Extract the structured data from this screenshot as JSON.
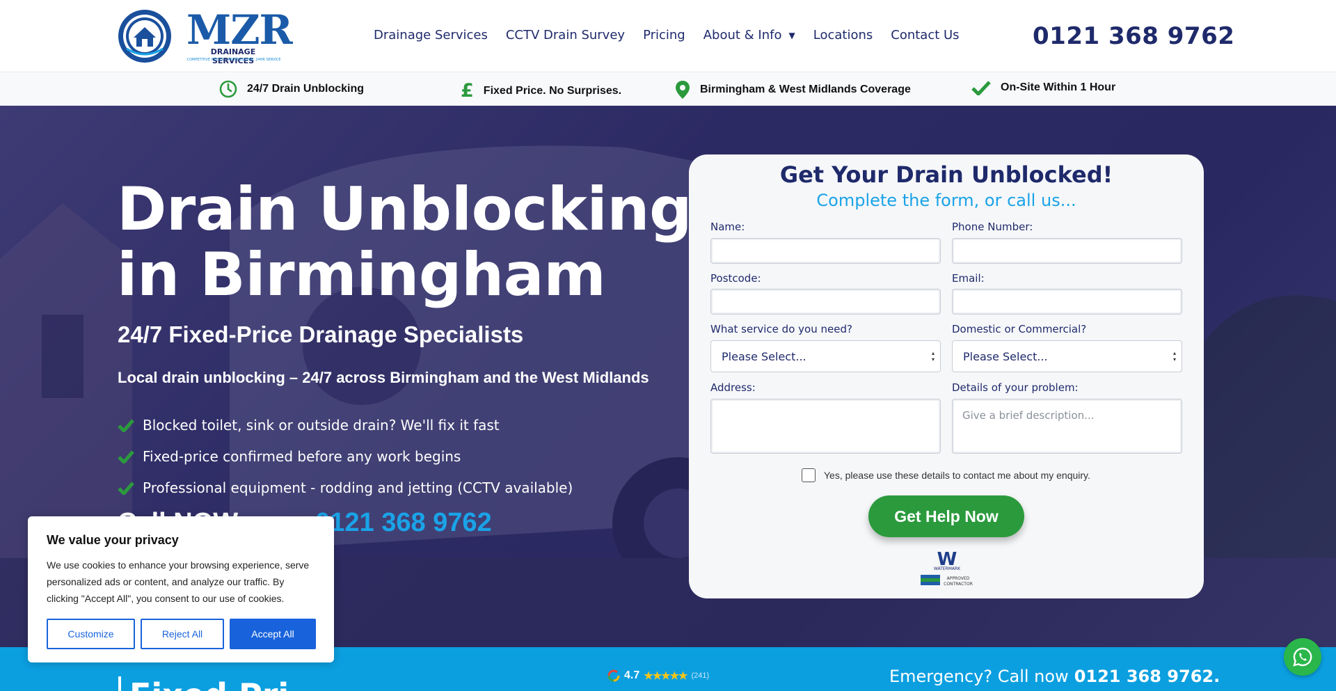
{
  "brand": {
    "name": "MZR",
    "subname": "DRAINAGE SERVICES",
    "tagline": "COMPETITIVE PRICES • PROFESSIONAL 24HR SERVICE",
    "colors": {
      "navy": "#1f2a6b",
      "accent_blue": "#1aa3e8",
      "green": "#2b9a3d",
      "bottom_bar": "#0b9fe0"
    }
  },
  "nav": {
    "items": [
      "Drainage Services",
      "CCTV Drain Survey",
      "Pricing",
      "About & Info",
      "Locations",
      "Contact Us"
    ],
    "dropdown_icon": "caret-down-icon"
  },
  "header_phone": "0121 368 9762",
  "usp": [
    {
      "icon": "clock-icon",
      "text": "24/7 Drain Unblocking"
    },
    {
      "icon": "pound-icon",
      "text": "Fixed Price. No Surprises."
    },
    {
      "icon": "map-pin-icon",
      "text": "Birmingham & West Midlands Coverage"
    },
    {
      "icon": "check-icon",
      "text": "On-Site Within 1 Hour"
    }
  ],
  "hero": {
    "title_line1": "Drain Unblocking",
    "title_line2": "in Birmingham",
    "subtitle": "24/7 Fixed-Price Drainage Specialists",
    "subtitle2": "Local drain unblocking – 24/7 across Birmingham and the West Midlands",
    "checklist": [
      "Blocked toilet, sink or outside drain? We'll fix it fast",
      "Fixed-price confirmed before any work begins",
      "Professional equipment - rodding and jetting (CCTV available)"
    ],
    "call_label": "Call NOW on",
    "call_number": "0121 368 9762"
  },
  "form": {
    "title": "Get Your Drain Unblocked!",
    "subtitle": "Complete the form, or call us...",
    "labels": {
      "name": "Name:",
      "phone": "Phone Number:",
      "postcode": "Postcode:",
      "email": "Email:",
      "service": "What service do you need?",
      "type": "Domestic or Commercial?",
      "address": "Address:",
      "details": "Details of your problem:"
    },
    "service_value": "Please Select...",
    "type_value": "Please Select...",
    "details_placeholder": "Give a brief description...",
    "consent": "Yes, please use these details to contact me about my enquiry.",
    "submit": "Get Help Now",
    "badge": {
      "brand": "WATERMARK",
      "line1": "APPROVED",
      "line2": "CONTRACTOR"
    }
  },
  "cookie": {
    "title": "We value your privacy",
    "body": "We use cookies to enhance your browsing experience, serve personalized ads or content, and analyze our traffic. By clicking \"Accept All\", you consent to our use of cookies.",
    "customize": "Customize",
    "reject": "Reject All",
    "accept": "Accept All"
  },
  "bottom": {
    "heading": "Fixed Pri",
    "rating": "4.7",
    "rating_stars": "★★★★★",
    "rating_count": "(241)",
    "emergency_label": "Emergency? Call now",
    "emergency_number": "0121 368 9762."
  }
}
